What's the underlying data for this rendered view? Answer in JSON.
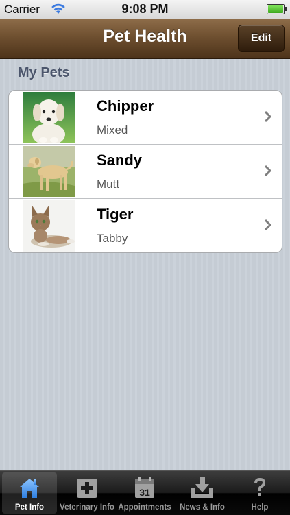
{
  "status_bar": {
    "carrier": "Carrier",
    "time": "9:08 PM",
    "battery_level": 1.0
  },
  "nav": {
    "title": "Pet Health",
    "edit_label": "Edit",
    "bar_color": "#6f5030"
  },
  "section": {
    "title": "My Pets"
  },
  "pets": [
    {
      "name": "Chipper",
      "breed": "Mixed",
      "photo": "white-puppy"
    },
    {
      "name": "Sandy",
      "breed": "Mutt",
      "photo": "yellow-labrador"
    },
    {
      "name": "Tiger",
      "breed": "Tabby",
      "photo": "tabby-kitten"
    }
  ],
  "tabs": [
    {
      "label": "Pet Info",
      "icon": "house-icon",
      "active": true
    },
    {
      "label": "Veterinary Info",
      "icon": "medical-cross-icon",
      "active": false
    },
    {
      "label": "Appointments",
      "icon": "calendar-icon",
      "active": false,
      "icon_text": "31"
    },
    {
      "label": "News & Info",
      "icon": "download-tray-icon",
      "active": false
    },
    {
      "label": "Help",
      "icon": "question-mark-icon",
      "active": false
    }
  ],
  "colors": {
    "active_tab_icon": "#4a90e2",
    "section_title": "#4c566c"
  }
}
